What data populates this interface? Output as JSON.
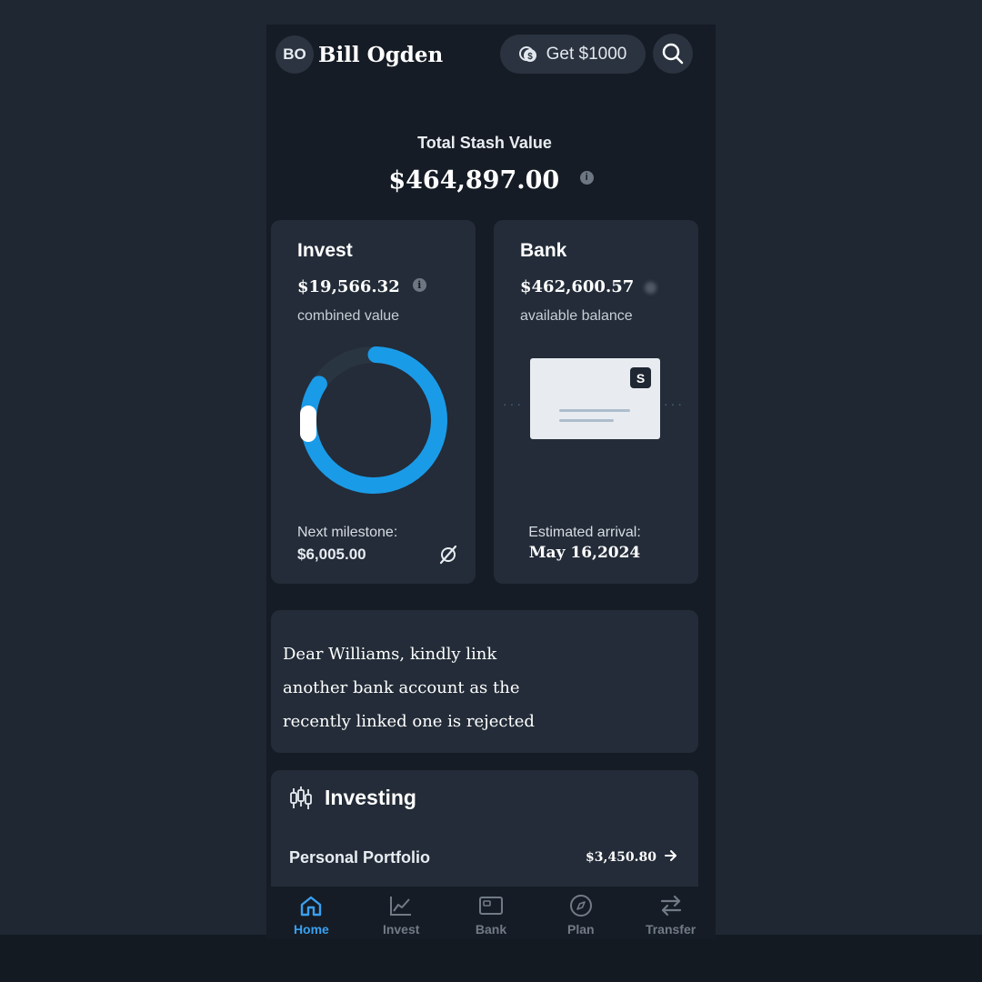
{
  "header": {
    "avatar_initials": "BO",
    "user_name": "Bill Ogden",
    "promo_label": "Get $1000"
  },
  "summary": {
    "label": "Total Stash Value",
    "value": "$464,897.00"
  },
  "invest_card": {
    "title": "Invest",
    "amount": "$19,566.32",
    "subtitle": "combined value",
    "milestone_label": "Next milestone:",
    "milestone_value": "$6,005.00",
    "progress_fraction": 0.9,
    "progress_color": "#1a9be8"
  },
  "bank_card": {
    "title": "Bank",
    "amount": "$462,600.57",
    "subtitle": "available balance",
    "cheque_badge": "S",
    "arrival_label": "Estimated arrival:",
    "arrival_value": "May 16,2024"
  },
  "notice": {
    "lines": [
      "Dear Williams, kindly link",
      "another bank account as the",
      "recently linked one is rejected"
    ]
  },
  "investing": {
    "title": "Investing",
    "portfolio_label": "Personal Portfolio",
    "portfolio_value": "$3,450.80"
  },
  "nav": {
    "items": [
      {
        "label": "Home",
        "icon": "home-icon",
        "active": true
      },
      {
        "label": "Invest",
        "icon": "chart-icon",
        "active": false
      },
      {
        "label": "Bank",
        "icon": "card-icon",
        "active": false
      },
      {
        "label": "Plan",
        "icon": "compass-icon",
        "active": false
      },
      {
        "label": "Transfer",
        "icon": "transfer-icon",
        "active": false
      }
    ]
  },
  "colors": {
    "background": "#1f2733",
    "card": "#232c38",
    "accent": "#3aa0f0"
  }
}
